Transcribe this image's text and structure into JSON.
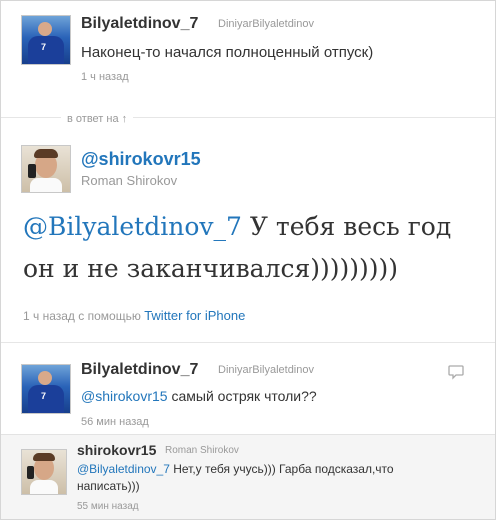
{
  "tweet_top": {
    "screen_name": "Bilyaletdinov_7",
    "full_name": "DiniyarBilyaletdinov",
    "text": "Наконец-то начался полноценный отпуск)",
    "time": "1 ч назад"
  },
  "in_reply_to": {
    "label": "в ответ на",
    "arrow": "↑"
  },
  "tweet_main": {
    "screen_name": "@shirokovr15",
    "full_name": "Roman Shirokov",
    "mention": "@Bilyaletdinov_7",
    "text_line1_rest": " У тебя весь год",
    "text_line2": "он и не заканчивался)))))))))",
    "time": "1 ч назад",
    "via_prefix": "с помощью",
    "via_client": "Twitter for iPhone"
  },
  "reply_1": {
    "screen_name": "Bilyaletdinov_7",
    "full_name": "DiniyarBilyaletdinov",
    "mention": "@shirokovr15",
    "text_rest": " самый остряк чтоли??",
    "time": "56 мин назад",
    "action_icon": "reply-bubble-icon"
  },
  "reply_2": {
    "screen_name": "shirokovr15",
    "full_name": "Roman Shirokov",
    "mention": "@Bilyaletdinov_7",
    "text_line1_rest": " Нет,у тебя учусь))) Гарба подсказал,что",
    "text_line2": "написать)))",
    "time": "55 мин назад"
  },
  "colors": {
    "link": "#2276bb",
    "meta": "#999999",
    "username": "#333333",
    "reply_background": "#f5f5f5"
  }
}
